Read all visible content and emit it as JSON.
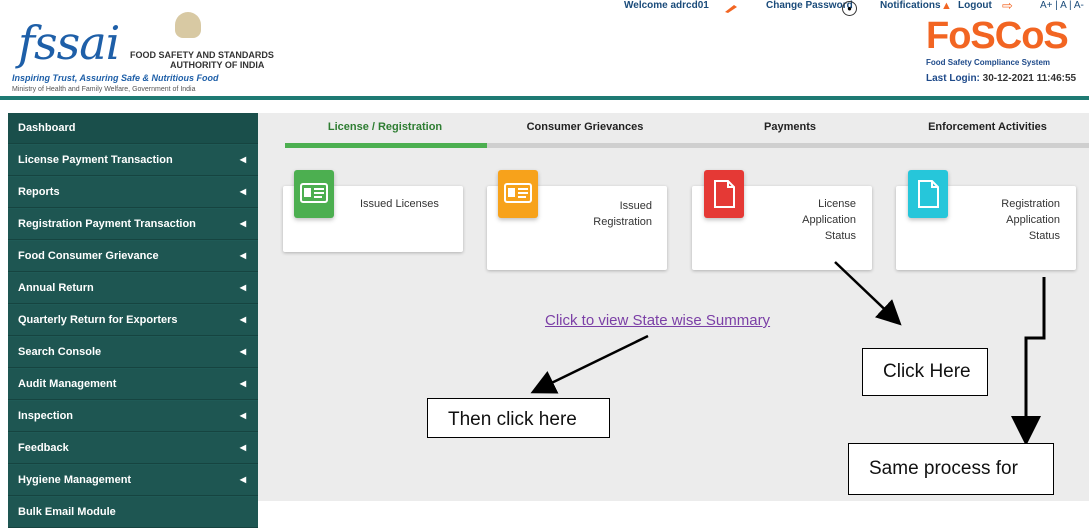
{
  "header": {
    "logo_text": "fssai",
    "authority_line1": "FOOD SAFETY AND STANDARDS",
    "authority_line2": "AUTHORITY OF INDIA",
    "tagline": "Inspiring Trust, Assuring Safe & Nutritious Food",
    "ministry": "Ministry of Health and Family Welfare, Government of India",
    "welcome": "Welcome adrcd01",
    "change_password": "Change Password",
    "notifications": "Notifications",
    "logout": "Logout",
    "font_controls": "A+ | A | A-",
    "brand": "FoSCoS",
    "brand_sub": "Food Safety Compliance System",
    "last_login_label": "Last Login:",
    "last_login_value": "30-12-2021 11:46:55"
  },
  "sidebar": {
    "items": [
      {
        "label": "Dashboard",
        "caret": false
      },
      {
        "label": "License Payment Transaction",
        "caret": true
      },
      {
        "label": "Reports",
        "caret": true
      },
      {
        "label": "Registration Payment Transaction",
        "caret": true
      },
      {
        "label": "Food Consumer Grievance",
        "caret": true
      },
      {
        "label": "Annual Return",
        "caret": true
      },
      {
        "label": "Quarterly Return for Exporters",
        "caret": true
      },
      {
        "label": "Search Console",
        "caret": true
      },
      {
        "label": "Audit Management",
        "caret": true
      },
      {
        "label": "Inspection",
        "caret": true
      },
      {
        "label": "Feedback",
        "caret": true
      },
      {
        "label": "Hygiene Management",
        "caret": true
      },
      {
        "label": "Bulk Email Module",
        "caret": false
      }
    ]
  },
  "tabs": [
    {
      "label": "License / Registration",
      "active": true
    },
    {
      "label": "Consumer Grievances",
      "active": false
    },
    {
      "label": "Payments",
      "active": false
    },
    {
      "label": "Enforcement Activities",
      "active": false
    }
  ],
  "cards": [
    {
      "line1": "Issued Licenses",
      "line2": "",
      "line3": "",
      "icon": "id-card-icon",
      "color": "#4caf50"
    },
    {
      "line1": "Issued",
      "line2": "Registration",
      "line3": "",
      "icon": "id-card-icon",
      "color": "#f7a21b"
    },
    {
      "line1": "License",
      "line2": "Application",
      "line3": "Status",
      "icon": "document-icon",
      "color": "#e53935"
    },
    {
      "line1": "Registration",
      "line2": "Application",
      "line3": "Status",
      "icon": "document-icon",
      "color": "#26c6da"
    }
  ],
  "summary_link": "Click to view State wise Summary",
  "callouts": {
    "click_here": "Click Here",
    "then_click": "Then click here",
    "same_process": "Same process for"
  },
  "colors": {
    "sidebar_bg": "#1e5652",
    "accent_green": "#4caf50",
    "brand_orange": "#f26522",
    "link_purple": "#7b3fa6"
  }
}
